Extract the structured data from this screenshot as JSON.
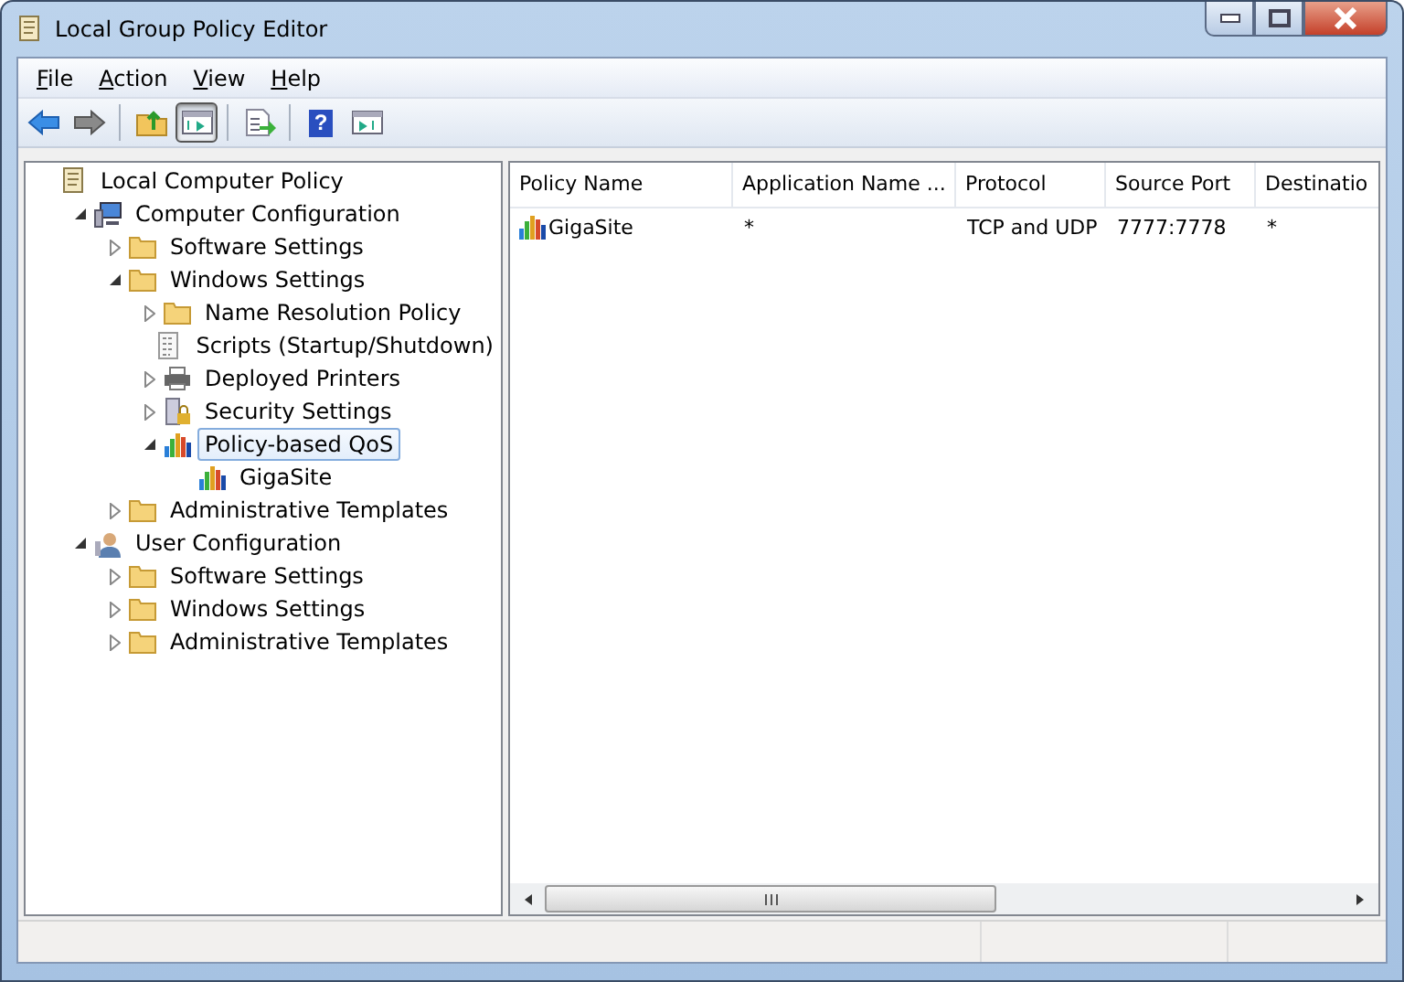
{
  "window": {
    "title": "Local Group Policy Editor"
  },
  "menu": [
    "File",
    "Action",
    "View",
    "Help"
  ],
  "toolbar": [
    {
      "kind": "back",
      "pressed": false
    },
    {
      "kind": "forward",
      "pressed": false
    },
    {
      "kind": "up",
      "pressed": false
    },
    {
      "kind": "tree",
      "pressed": true
    },
    {
      "kind": "export",
      "pressed": false
    },
    {
      "kind": "help",
      "pressed": false,
      "glyph": "?"
    },
    {
      "kind": "action",
      "pressed": false
    }
  ],
  "tree": [
    {
      "label": "Local Computer Policy",
      "kind": "scroll",
      "selected": false,
      "children": [
        {
          "label": "Computer Configuration",
          "kind": "computer",
          "selected": false,
          "expanded": true,
          "children": [
            {
              "label": "Software Settings",
              "kind": "folder",
              "selected": false,
              "expanded": false
            },
            {
              "label": "Windows Settings",
              "kind": "folder",
              "selected": false,
              "expanded": true,
              "children": [
                {
                  "label": "Name Resolution Policy",
                  "kind": "folder",
                  "selected": false,
                  "expanded": false
                },
                {
                  "label": "Scripts (Startup/Shutdown)",
                  "kind": "script",
                  "selected": false
                },
                {
                  "label": "Deployed Printers",
                  "kind": "printer",
                  "selected": false,
                  "expanded": false
                },
                {
                  "label": "Security Settings",
                  "kind": "security",
                  "selected": false,
                  "expanded": false
                },
                {
                  "label": "Policy-based QoS",
                  "kind": "qos",
                  "selected": true,
                  "expanded": true,
                  "children": [
                    {
                      "label": "GigaSite",
                      "kind": "qos",
                      "selected": false
                    }
                  ]
                }
              ]
            },
            {
              "label": "Administrative Templates",
              "kind": "folder",
              "selected": false,
              "expanded": false
            }
          ]
        },
        {
          "label": "User Configuration",
          "kind": "user",
          "selected": false,
          "expanded": true,
          "children": [
            {
              "label": "Software Settings",
              "kind": "folder",
              "selected": false,
              "expanded": false
            },
            {
              "label": "Windows Settings",
              "kind": "folder",
              "selected": false,
              "expanded": false
            },
            {
              "label": "Administrative Templates",
              "kind": "folder",
              "selected": false,
              "expanded": false
            }
          ]
        }
      ]
    }
  ],
  "table": {
    "columns": [
      "Policy Name",
      "Application Name ...",
      "Protocol",
      "Source Port",
      "Destinatio"
    ],
    "rows": [
      {
        "cells": [
          "GigaSite",
          "*",
          "TCP and UDP",
          "7777:7778",
          "*"
        ]
      }
    ]
  }
}
